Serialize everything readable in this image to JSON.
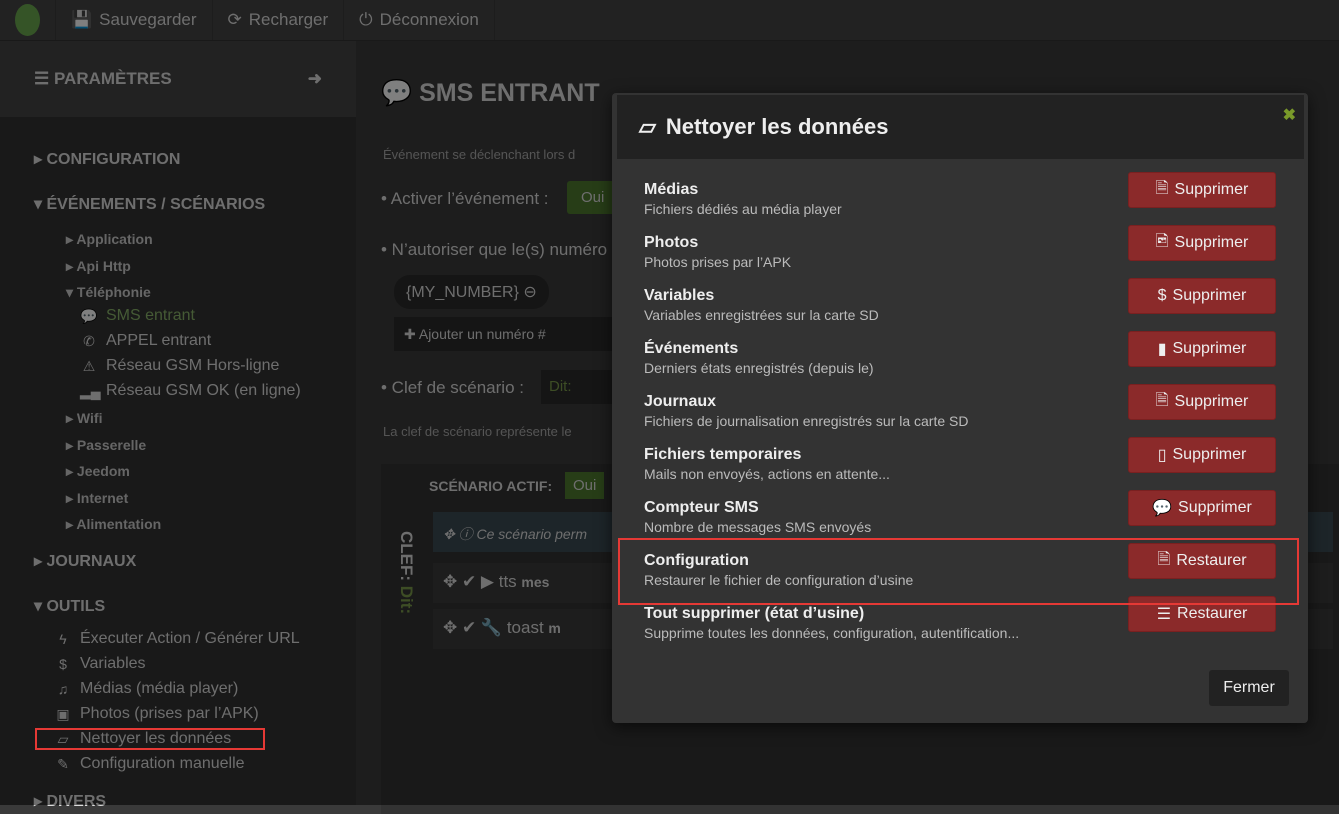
{
  "topbar": {
    "save": "Sauvegarder",
    "reload": "Recharger",
    "logout": "Déconnexion"
  },
  "sidebar": {
    "title": "PARAMÈTRES",
    "sections": {
      "configuration": "CONFIGURATION",
      "events": "ÉVÉNEMENTS / SCÉNARIOS",
      "journaux": "JOURNAUX",
      "outils": "OUTILS",
      "divers": "DIVERS"
    },
    "events_items": [
      "Application",
      "Api Http",
      "Téléphonie",
      "Wifi",
      "Passerelle",
      "Jeedom",
      "Internet",
      "Alimentation"
    ],
    "telephonie_items": [
      "SMS entrant",
      "APPEL entrant",
      "Réseau GSM Hors-ligne",
      "Réseau GSM OK (en ligne)"
    ],
    "outils_items": [
      "Éxecuter Action / Générer URL",
      "Variables",
      "Médias (média player)",
      "Photos (prises par l’APK)",
      "Nettoyer les données",
      "Configuration manuelle"
    ]
  },
  "main": {
    "title": "SMS ENTRANT",
    "info1": "Événement se déclenchant lors d",
    "activate_label": "• Activer l’événement :",
    "oui": "Oui",
    "numbers_label": "• N’autoriser que le(s) numéro",
    "number_tag": "{MY_NUMBER}",
    "add_number": "Ajouter un numéro",
    "key_label": "• Clef de scénario :",
    "key_value": "Dit:",
    "info2": "La clef de scénario représente le",
    "scenario_active": "SCÉNARIO ACTIF:",
    "clef": "CLEF:",
    "clef_value": "Dit:",
    "scenario_info": "Ce scénario perm",
    "action1": "tts",
    "action1_arg": "mes",
    "action2": "toast",
    "action2_arg": "m"
  },
  "modal": {
    "title": "Nettoyer les données",
    "rows": [
      {
        "title": "Médias",
        "desc": "Fichiers dédiés au média player",
        "button": "Supprimer",
        "icon": "file-audio-icon"
      },
      {
        "title": "Photos",
        "desc": "Photos prises par l’APK",
        "button": "Supprimer",
        "icon": "file-image-icon"
      },
      {
        "title": "Variables",
        "desc": "Variables enregistrées sur la carte SD",
        "button": "Supprimer",
        "icon": "dollar-icon"
      },
      {
        "title": "Événements",
        "desc": "Derniers états enregistrés (depuis le)",
        "button": "Supprimer",
        "icon": "file-icon"
      },
      {
        "title": "Journaux",
        "desc": "Fichiers de journalisation enregistrés sur la carte SD",
        "button": "Supprimer",
        "icon": "file-text-icon"
      },
      {
        "title": "Fichiers temporaires",
        "desc": "Mails non envoyés, actions en attente...",
        "button": "Supprimer",
        "icon": "file-outline-icon"
      },
      {
        "title": "Compteur SMS",
        "desc": "Nombre de messages SMS envoyés",
        "button": "Supprimer",
        "icon": "comments-icon"
      },
      {
        "title": "Configuration",
        "desc": "Restaurer le fichier de configuration d’usine",
        "button": "Restaurer",
        "icon": "file-code-icon"
      },
      {
        "title": "Tout supprimer (état d’usine)",
        "desc": "Supprime toutes les données, configuration, autentification...",
        "button": "Restaurer",
        "icon": "sliders-icon"
      }
    ],
    "close_label": "Fermer"
  },
  "colors": {
    "danger": "#8b2a2a",
    "accent_green": "#6aa84f",
    "highlight": "#e53935"
  }
}
